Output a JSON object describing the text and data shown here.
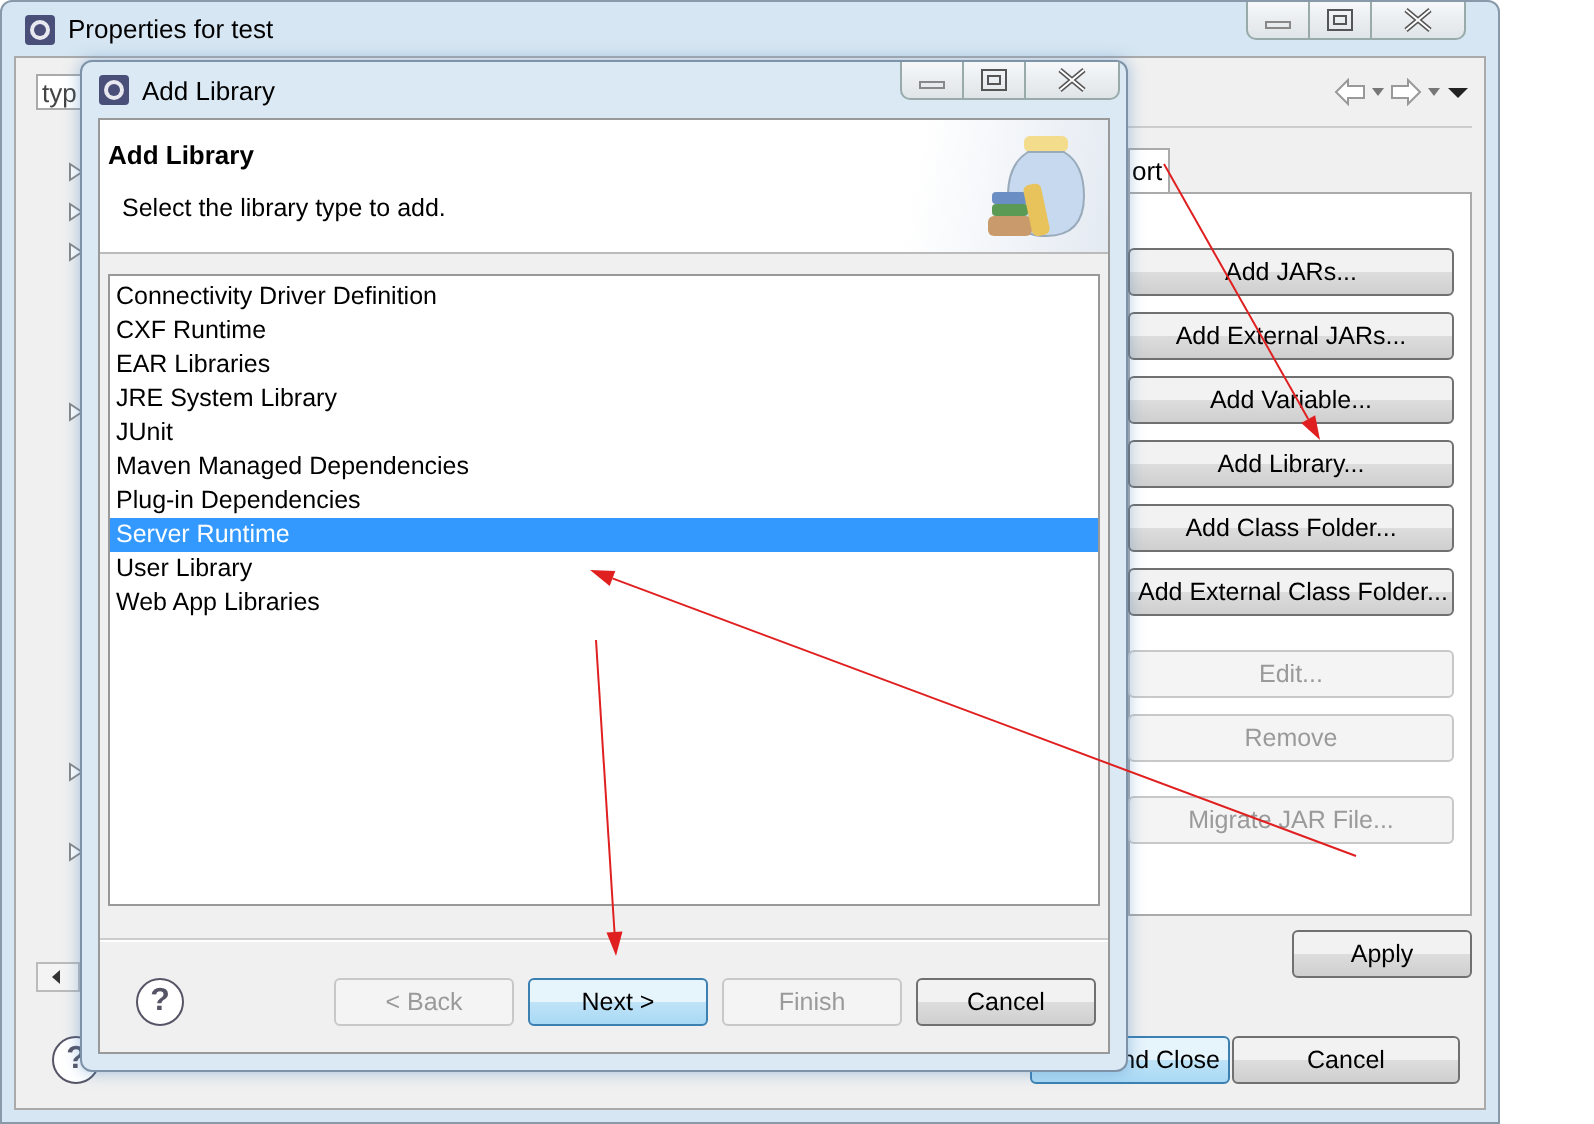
{
  "properties_window": {
    "title": "Properties for test",
    "filter": {
      "value": "typ"
    },
    "tab": {
      "label": "ort"
    },
    "buttons": [
      {
        "label": "Add JARs...",
        "disabled": false
      },
      {
        "label": "Add External JARs...",
        "disabled": false
      },
      {
        "label": "Add Variable...",
        "disabled": false
      },
      {
        "label": "Add Library...",
        "disabled": false
      },
      {
        "label": "Add Class Folder...",
        "disabled": false
      },
      {
        "label": "Add External Class Folder...",
        "disabled": false
      },
      {
        "label": "Edit...",
        "disabled": true
      },
      {
        "label": "Remove",
        "disabled": true
      },
      {
        "label": "Migrate JAR File...",
        "disabled": true
      }
    ],
    "apply_button": "Apply",
    "help_button": "?",
    "ok_button": "nd Close",
    "cancel_button": "Cancel"
  },
  "add_library_dialog": {
    "title": "Add Library",
    "header_title": "Add Library",
    "header_message": "Select the library type to add.",
    "help_button": "?",
    "items": [
      {
        "label": "Connectivity Driver Definition",
        "selected": false
      },
      {
        "label": "CXF Runtime",
        "selected": false
      },
      {
        "label": "EAR Libraries",
        "selected": false
      },
      {
        "label": "JRE System Library",
        "selected": false
      },
      {
        "label": "JUnit",
        "selected": false
      },
      {
        "label": "Maven Managed Dependencies",
        "selected": false
      },
      {
        "label": "Plug-in Dependencies",
        "selected": false
      },
      {
        "label": "Server Runtime",
        "selected": true
      },
      {
        "label": "User Library",
        "selected": false
      },
      {
        "label": "Web App Libraries",
        "selected": false
      }
    ],
    "buttons": [
      {
        "label": "< Back",
        "disabled": true,
        "default": false
      },
      {
        "label": "Next >",
        "disabled": false,
        "default": true
      },
      {
        "label": "Finish",
        "disabled": true,
        "default": false
      },
      {
        "label": "Cancel",
        "disabled": false,
        "default": false
      }
    ]
  }
}
